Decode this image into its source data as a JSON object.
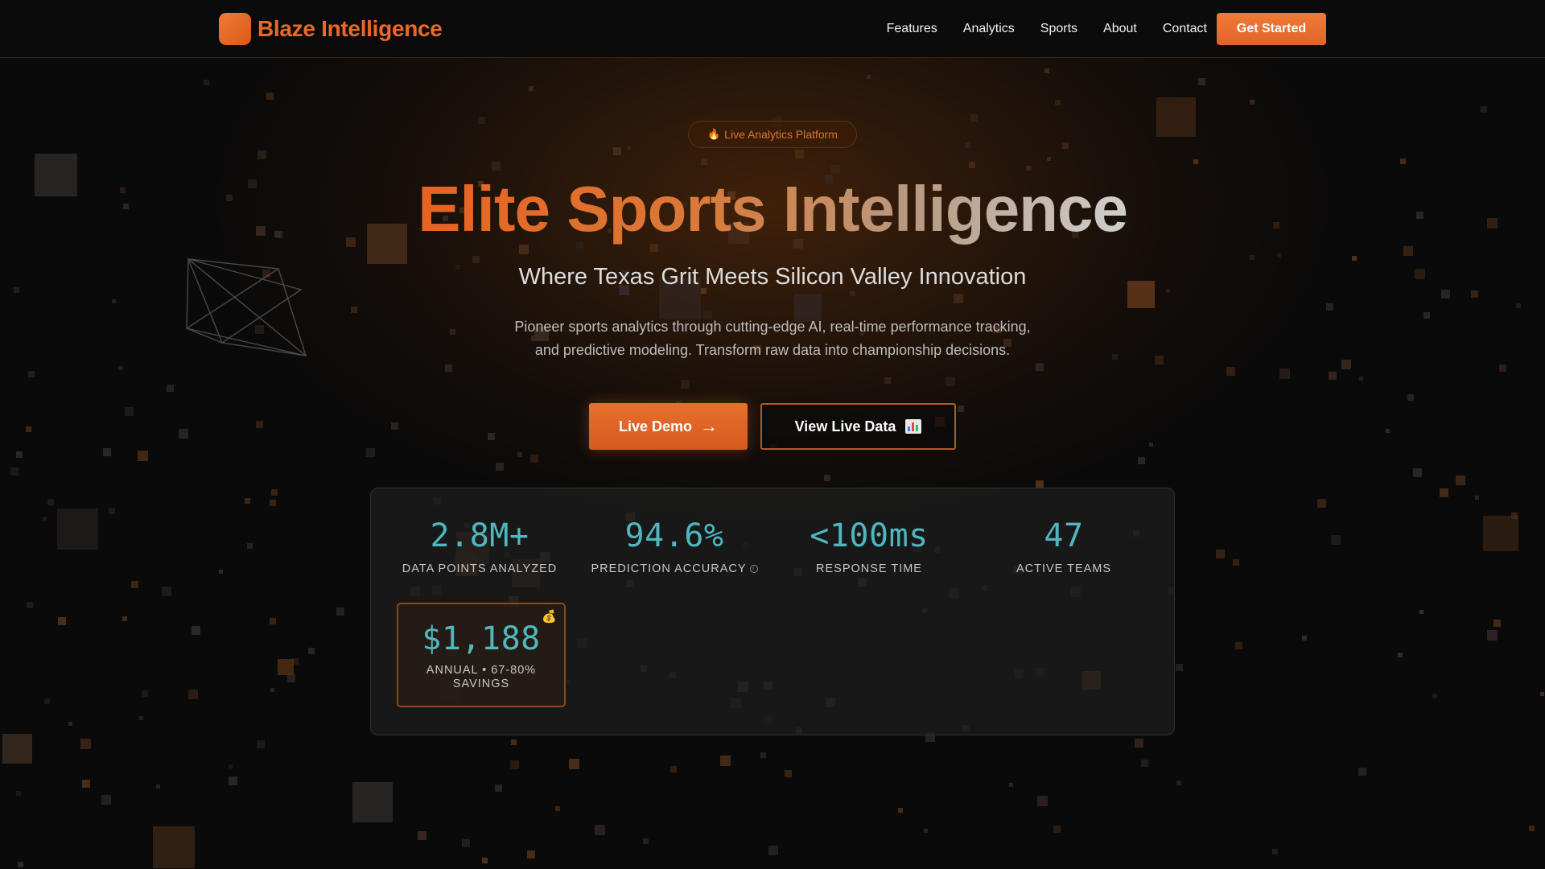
{
  "brand": {
    "name": "Blaze Intelligence"
  },
  "nav": {
    "links": [
      "Features",
      "Analytics",
      "Sports",
      "About",
      "Contact"
    ],
    "cta": "Get Started"
  },
  "hero": {
    "badge": "Live Analytics Platform",
    "badge_icon": "flame-icon",
    "title": "Elite Sports Intelligence",
    "subtitle": "Where Texas Grit Meets Silicon Valley Innovation",
    "description_line1": "Pioneer sports analytics through cutting-edge AI, real-time performance tracking,",
    "description_line2": "and predictive modeling. Transform raw data into championship decisions.",
    "primary_button": "Live Demo",
    "primary_button_icon": "→",
    "secondary_button": "View Live Data",
    "secondary_button_icon": "bar-chart-icon"
  },
  "stats": [
    {
      "value": "2.8M+",
      "label": "DATA POINTS ANALYZED"
    },
    {
      "value": "94.6%",
      "label": "PREDICTION ACCURACY"
    },
    {
      "value": "<100ms",
      "label": "RESPONSE TIME"
    },
    {
      "value": "47",
      "label": "ACTIVE TEAMS"
    }
  ],
  "savings": {
    "value": "$1,188",
    "label_line1": "ANNUAL • 67-80%",
    "label_line2": "SAVINGS",
    "icon": "money-bag-icon"
  },
  "colors": {
    "accent": "#e9682a",
    "stat_value": "#4fb7bf",
    "background": "#0a0a0a"
  }
}
